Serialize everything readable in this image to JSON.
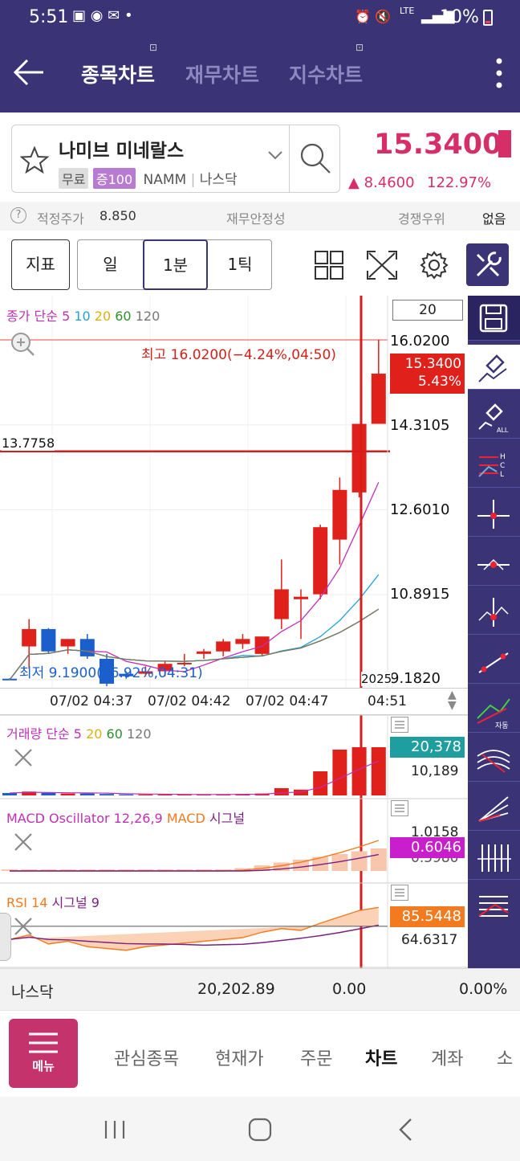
{
  "status_bar": {
    "time": "5:51",
    "battery": "10%",
    "network": "LTE"
  },
  "header": {
    "tabs": [
      "종목차트",
      "재무차트",
      "지수차트"
    ],
    "active_tab": 0
  },
  "stock": {
    "name": "나미브 미네랄스",
    "tags": [
      "무료",
      "증100"
    ],
    "ticker": "NAMM",
    "market": "나스닥",
    "price": "15.3400",
    "change": "▲ 8.4600",
    "change_pct": "122.97%"
  },
  "info_row": {
    "fair_price_label": "적정주가",
    "fair_price": "8.850",
    "stability_label": "재무안정성",
    "competition_label": "경쟁우위",
    "competition_value": "없음"
  },
  "toolbar": {
    "indicator": "지표",
    "periods": [
      "일",
      "1분",
      "1틱"
    ],
    "active_period": "1분"
  },
  "chart": {
    "ma_legend": {
      "prefix": "종가 단순",
      "items": [
        "5",
        "10",
        "20",
        "60",
        "120"
      ]
    },
    "count_box": "20",
    "price_labels": [
      "16.0200",
      "14.3105",
      "12.6010",
      "10.8915",
      "9.1820"
    ],
    "current_price_tag": "15.3400",
    "current_pct_tag": "5.43%",
    "high_note": "최고 16.0200(−4.24%,04:50)",
    "low_note": "최저 9.1900(66.92%,04:31)",
    "crosshair_value": "13.7758",
    "year_label": "2025",
    "time_labels": [
      "07/02 04:37",
      "07/02 04:42",
      "07/02 04:47",
      "04:51"
    ],
    "candles": [
      {
        "o": 9.2,
        "h": 9.21,
        "l": 9.19,
        "c": 9.18
      },
      {
        "o": 9.85,
        "h": 10.4,
        "l": 9.4,
        "c": 10.2
      },
      {
        "o": 10.2,
        "h": 10.22,
        "l": 9.7,
        "c": 9.75
      },
      {
        "o": 9.85,
        "h": 9.9,
        "l": 9.7,
        "c": 10.0
      },
      {
        "o": 10.0,
        "h": 10.1,
        "l": 9.6,
        "c": 9.65
      },
      {
        "o": 9.6,
        "h": 9.7,
        "l": 9.05,
        "c": 9.1
      },
      {
        "o": 9.3,
        "h": 9.35,
        "l": 9.2,
        "c": 9.25
      },
      {
        "o": 9.3,
        "h": 9.45,
        "l": 9.25,
        "c": 9.35
      },
      {
        "o": 9.35,
        "h": 9.55,
        "l": 9.25,
        "c": 9.5
      },
      {
        "o": 9.5,
        "h": 9.7,
        "l": 9.45,
        "c": 9.52
      },
      {
        "o": 9.7,
        "h": 9.8,
        "l": 9.6,
        "c": 9.75
      },
      {
        "o": 9.75,
        "h": 10.0,
        "l": 9.65,
        "c": 9.95
      },
      {
        "o": 9.9,
        "h": 10.1,
        "l": 9.8,
        "c": 10.0
      },
      {
        "o": 9.7,
        "h": 10.0,
        "l": 9.65,
        "c": 10.05
      },
      {
        "o": 10.4,
        "h": 11.6,
        "l": 10.2,
        "c": 11.0
      },
      {
        "o": 10.8,
        "h": 11.0,
        "l": 10.0,
        "c": 10.85
      },
      {
        "o": 10.9,
        "h": 12.3,
        "l": 10.8,
        "c": 12.25
      },
      {
        "o": 12.0,
        "h": 13.25,
        "l": 11.5,
        "c": 13.0
      },
      {
        "o": 12.95,
        "h": 14.33,
        "l": 12.85,
        "c": 14.33
      },
      {
        "o": 14.33,
        "h": 16.02,
        "l": 14.33,
        "c": 15.34
      }
    ],
    "volume_legend": {
      "prefix": "거래량 단순",
      "items": [
        "5",
        "20",
        "60",
        "120"
      ]
    },
    "volume_tag": "20,378",
    "volume_label": "10,189",
    "macd_legend": {
      "prefix": "MACD Oscillator 12,26,9",
      "macd": "MACD",
      "signal": "시그널"
    },
    "macd_labels": [
      "1.0158",
      "0.5980"
    ],
    "macd_tag": "0.6046",
    "rsi_legend": {
      "prefix": "RSI 14",
      "signal": "시그널 9"
    },
    "rsi_tag": "85.5448",
    "rsi_label": "64.6317"
  },
  "colors": {
    "header": "#3a3477",
    "up": "#e0201b",
    "down": "#1a5fcc",
    "price": "#d62f67",
    "volume_tag": "#1e9e9e",
    "macd_tag": "#c81ecb",
    "rsi_tag": "#f37a1f"
  },
  "index_bar": {
    "name": "나스닥",
    "value": "20,202.89",
    "change": "0.00",
    "pct": "0.00%"
  },
  "bottom_nav": {
    "menu": "메뉴",
    "items": [
      "관심종목",
      "현재가",
      "주문",
      "차트",
      "계좌",
      "소"
    ],
    "active": "차트"
  }
}
